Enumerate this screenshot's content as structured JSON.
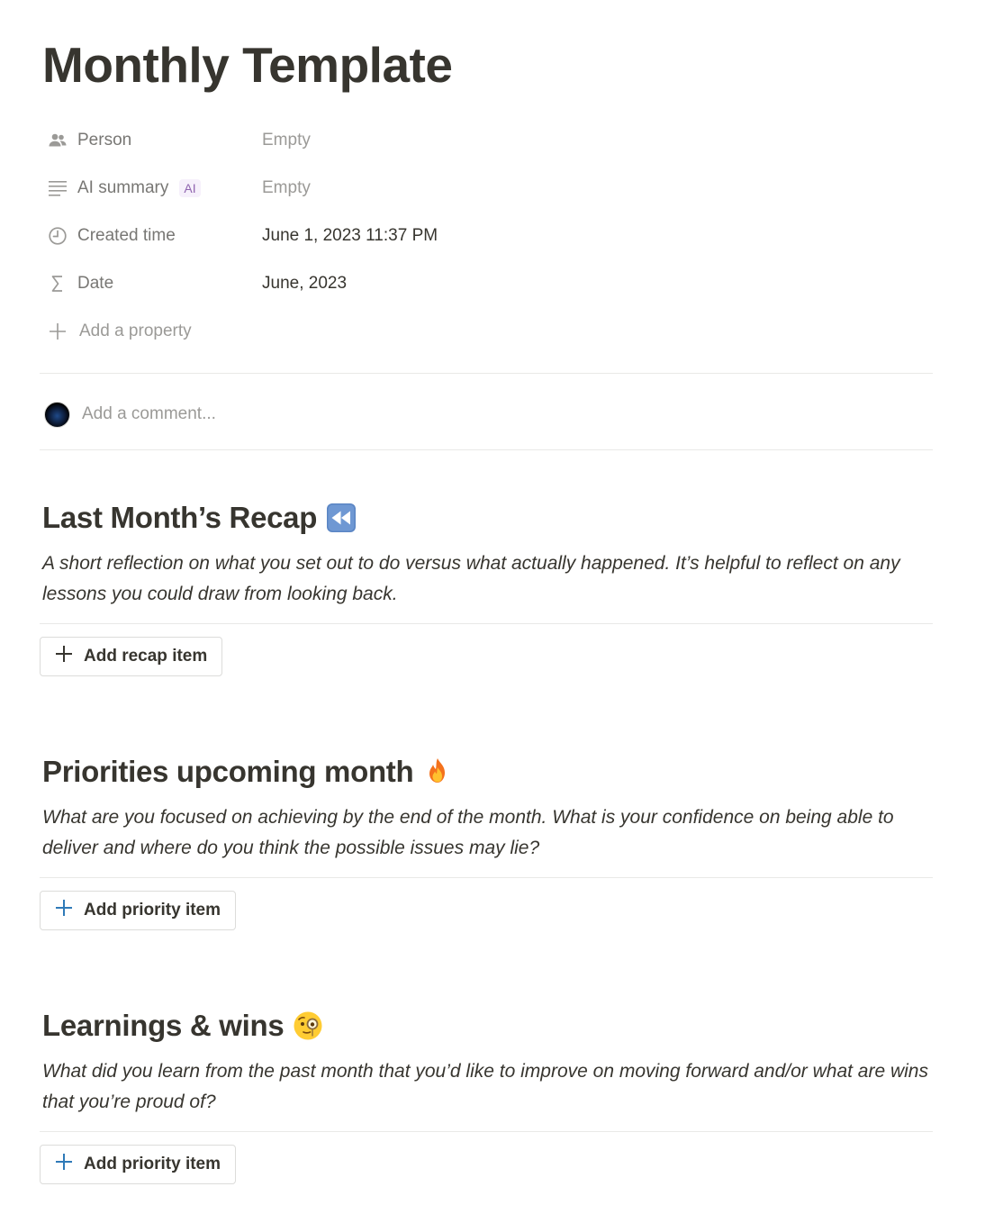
{
  "page": {
    "title": "Monthly Template"
  },
  "properties": [
    {
      "name": "Person",
      "icon": "people-icon",
      "value": "Empty",
      "empty": true
    },
    {
      "name": "AI summary",
      "icon": "lines-icon",
      "badge": "AI",
      "value": "Empty",
      "empty": true
    },
    {
      "name": "Created time",
      "icon": "clock-icon",
      "value": "June 1, 2023 11:37 PM",
      "empty": false
    },
    {
      "name": "Date",
      "icon": "sigma-icon",
      "value": "June, 2023",
      "empty": false
    }
  ],
  "add_property_label": "Add a property",
  "comment": {
    "placeholder": "Add a comment..."
  },
  "sections": [
    {
      "heading": "Last Month’s Recap",
      "emoji": "rewind-emoji",
      "description": "A short reflection on what you set out to do versus what actually happened. It’s helpful to reflect on any lessons you could draw from looking back.",
      "button_label": "Add recap item",
      "plus_color": "#37352f"
    },
    {
      "heading": "Priorities upcoming month",
      "emoji": "fire-emoji",
      "description": "What are you focused on achieving by the end of the month. What is your confidence on being able to deliver and where do you think the possible issues may lie?",
      "button_label": "Add priority item",
      "plus_color": "#2f7ab8"
    },
    {
      "heading": "Learnings & wins",
      "emoji": "monocle-face-emoji",
      "description": "What did you learn from the past month that you’d like to improve on moving forward and/or what are wins that you’re proud of?",
      "button_label": "Add priority item",
      "plus_color": "#2f7ab8"
    }
  ],
  "colors": {
    "text": "#37352f",
    "muted": "#787774",
    "placeholder": "#9b9a97",
    "divider": "#e9e9e7",
    "ai_badge_bg": "#f6f0fb",
    "ai_badge_text": "#9065b0"
  }
}
